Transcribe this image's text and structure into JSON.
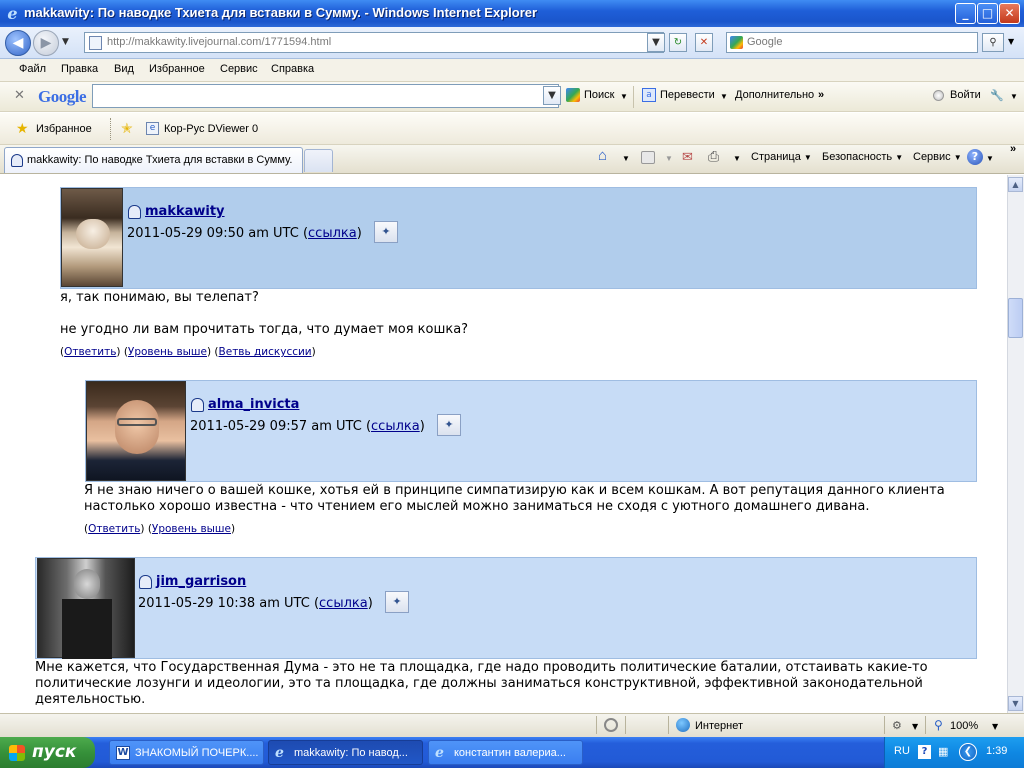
{
  "window": {
    "title": "makkawity: По наводке Тхиета для вставки в Сумму. - Windows Internet Explorer",
    "controls": {
      "minimize": "_",
      "maximize": "□",
      "close": "✕"
    }
  },
  "address_bar": {
    "url": "http://makkawity.livejournal.com/1771594.html",
    "search_placeholder": "Google"
  },
  "menu": [
    "Файл",
    "Правка",
    "Вид",
    "Избранное",
    "Сервис",
    "Справка"
  ],
  "google_toolbar": {
    "logo": "Google",
    "search_label": "Поиск",
    "translate_label": "Перевести",
    "more_label": "Дополнительно",
    "signin_label": "Войти"
  },
  "favorites_bar": {
    "favorites_label": "Избранное",
    "links": [
      "Кор-Рус DViewer 0"
    ]
  },
  "tabs": [
    {
      "label": "makkawity: По наводке Тхиета для вставки в Сумму.",
      "active": true
    }
  ],
  "command_bar": {
    "page": "Страница",
    "safety": "Безопасность",
    "tools": "Сервис",
    "help": "?"
  },
  "comments": [
    {
      "username": "makkawity",
      "date": "2011-05-29 09:50 am UTC",
      "link_label": "ссылка",
      "text_lines": [
        "я, так понимаю, вы телепат?",
        "",
        "не угодно ли вам прочитать тогда, что думает моя кошка?"
      ],
      "actions": [
        "Ответить",
        "Уровень выше",
        "Ветвь дискуссии"
      ]
    },
    {
      "username": "alma_invicta",
      "date": "2011-05-29 09:57 am UTC",
      "link_label": "ссылка",
      "text_lines": [
        "Я не знаю ничего о вашей кошке, хотья ей в принципе симпатизирую как и всем кошкам. А вот репутация данного клиента",
        "настолько хорошо известна - что чтением его мыслей можно заниматься не сходя с уютного домашнего дивана."
      ],
      "actions": [
        "Ответить",
        "Уровень выше"
      ]
    },
    {
      "username": "jim_garrison",
      "date": "2011-05-29 10:38 am UTC",
      "link_label": "ссылка",
      "text_lines": [
        "Мне кажется, что Государственная Дума - это не та площадка, где надо проводить политические баталии, отстаивать какие-то",
        "политические лозунги и идеологии, это та площадка, где должны заниматься конструктивной, эффективной законодательной",
        "деятельностью."
      ],
      "actions": []
    }
  ],
  "status_bar": {
    "zone": "Интернет",
    "zoom": "100%"
  },
  "taskbar": {
    "start": "пуск",
    "tasks": [
      {
        "label": "ЗНАКОМЫЙ ПОЧЕРК....",
        "active": false
      },
      {
        "label": "makkawity: По навод...",
        "active": true
      },
      {
        "label": "константин валериа...",
        "active": false
      }
    ],
    "language": "RU",
    "clock": "1:39"
  }
}
